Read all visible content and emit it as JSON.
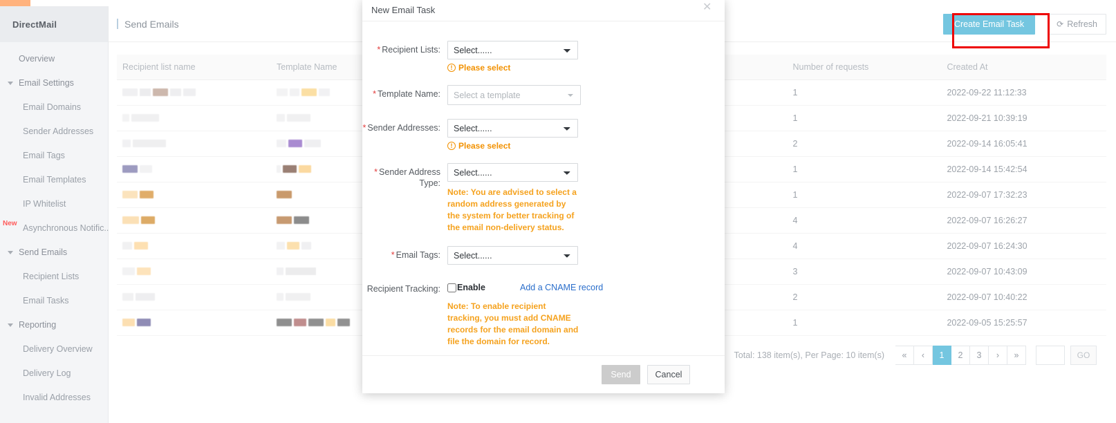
{
  "brand": {
    "name": "DirectMail"
  },
  "sidebar": {
    "items": [
      {
        "label": "Overview",
        "level": 0,
        "caret": false,
        "badge": null
      },
      {
        "label": "Email Settings",
        "level": 0,
        "caret": true,
        "badge": null
      },
      {
        "label": "Email Domains",
        "level": 1,
        "caret": false,
        "badge": null
      },
      {
        "label": "Sender Addresses",
        "level": 1,
        "caret": false,
        "badge": null
      },
      {
        "label": "Email Tags",
        "level": 1,
        "caret": false,
        "badge": null
      },
      {
        "label": "Email Templates",
        "level": 1,
        "caret": false,
        "badge": null
      },
      {
        "label": "IP Whitelist",
        "level": 1,
        "caret": false,
        "badge": null
      },
      {
        "label": "Asynchronous Notific...",
        "level": 1,
        "caret": false,
        "badge": "New"
      },
      {
        "label": "Send Emails",
        "level": 0,
        "caret": true,
        "badge": null
      },
      {
        "label": "Recipient Lists",
        "level": 1,
        "caret": false,
        "badge": null
      },
      {
        "label": "Email Tasks",
        "level": 1,
        "caret": false,
        "badge": null
      },
      {
        "label": "Reporting",
        "level": 0,
        "caret": true,
        "badge": null
      },
      {
        "label": "Delivery Overview",
        "level": 1,
        "caret": false,
        "badge": null
      },
      {
        "label": "Delivery Log",
        "level": 1,
        "caret": false,
        "badge": null
      },
      {
        "label": "Invalid Addresses",
        "level": 1,
        "caret": false,
        "badge": null
      }
    ]
  },
  "header": {
    "title": "Send Emails",
    "create_button": "Create Email Task",
    "refresh_button": "Refresh",
    "refresh_icon": "refresh-icon",
    "highlight_color": "#ee0000",
    "primary_color": "#74c6e0"
  },
  "table": {
    "columns": [
      "Recipient list name",
      "Template Name",
      "",
      "",
      "Number of requests",
      "Created At"
    ],
    "rows": [
      {
        "requests": "1",
        "created": "2022-09-22 11:12:33"
      },
      {
        "requests": "1",
        "created": "2022-09-21 10:39:19"
      },
      {
        "requests": "2",
        "created": "2022-09-14 16:05:41"
      },
      {
        "requests": "1",
        "created": "2022-09-14 15:42:54"
      },
      {
        "requests": "1",
        "created": "2022-09-07 17:32:23"
      },
      {
        "requests": "4",
        "created": "2022-09-07 16:26:27"
      },
      {
        "requests": "4",
        "created": "2022-09-07 16:24:30"
      },
      {
        "requests": "3",
        "created": "2022-09-07 10:43:09"
      },
      {
        "requests": "2",
        "created": "2022-09-07 10:40:22"
      },
      {
        "requests": "1",
        "created": "2022-09-05 15:25:57"
      }
    ]
  },
  "pagination": {
    "summary": "Total: 138 item(s), Per Page: 10 item(s)",
    "first": "«",
    "prev": "‹",
    "pages": [
      "1",
      "2",
      "3"
    ],
    "active_page": "1",
    "next": "›",
    "last": "»",
    "jump_value": "",
    "go_label": "GO"
  },
  "modal": {
    "title": "New Email Task",
    "close_icon": "close-icon",
    "fields": {
      "recipient_lists": {
        "label": "Recipient Lists:",
        "required": true,
        "value": "Select......",
        "error": "Please select"
      },
      "template_name": {
        "label": "Template Name:",
        "required": true,
        "placeholder": "Select a template",
        "value": "Select a template"
      },
      "sender_addresses": {
        "label": "Sender Addresses:",
        "required": true,
        "value": "Select......",
        "error": "Please select"
      },
      "sender_address_type": {
        "label": "Sender Address Type:",
        "required": true,
        "value": "Select......",
        "note": "Note: You are advised to select a random address generated by the system for better tracking of the email non-delivery status."
      },
      "email_tags": {
        "label": "Email Tags:",
        "required": true,
        "value": "Select......"
      },
      "recipient_tracking": {
        "label": "Recipient Tracking:",
        "required": false,
        "checkbox_label": "Enable",
        "checked": false,
        "link": "Add a CNAME record",
        "note": "Note: To enable recipient tracking, you must add CNAME records for the email domain and file the domain for record."
      }
    },
    "footer": {
      "send": "Send",
      "cancel": "Cancel"
    }
  }
}
